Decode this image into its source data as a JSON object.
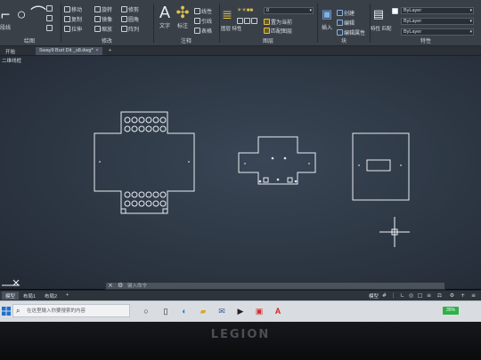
{
  "ribbon": {
    "draw_group_label": "绘图",
    "modify_group_label": "修改",
    "annotation_group_label": "注释",
    "layers_group_label": "图层",
    "block_group_label": "块",
    "properties_group_label": "特性",
    "tools": {
      "polyline": "段线",
      "move": "移动",
      "rotate": "旋转",
      "trim": "修剪",
      "copy": "复制",
      "mirror": "镜像",
      "fillet": "圆角",
      "stretch": "拉伸",
      "scale": "缩放",
      "array": "阵列",
      "text": "文字",
      "dimension": "标注",
      "linear": "线性",
      "leader": "引线",
      "table": "表格",
      "layer_properties": "图层\n特性",
      "layer_value": "0",
      "set_current": "置为当前",
      "match_layer": "匹配图层",
      "insert": "插入",
      "create": "创建",
      "edit": "编辑",
      "edit_attributes": "编辑属性",
      "match_properties": "特性\n匹配",
      "bylayer_color": "ByLayer",
      "bylayer_linetype": "ByLayer",
      "bylayer_lineweight": "ByLayer"
    }
  },
  "tabs": {
    "start": "开始",
    "document": "Sway9 Burt Dit _s8.dwg*",
    "new_tab": "+"
  },
  "viewport": {
    "label": "二维线框"
  },
  "command": {
    "placeholder": "键入命令"
  },
  "layout_tabs": [
    "模型",
    "布局1",
    "布局2",
    "+"
  ],
  "statusbar": {
    "model_label": "模型"
  },
  "taskbar": {
    "search_placeholder": "在这里输入你要搜索的内容",
    "battery": "35%"
  },
  "bezel": {
    "brand": "LEGION"
  },
  "colors": {
    "ribbon_bg": "#3a4048",
    "canvas_bg": "#2d3744",
    "drawing_line": "#ffffff",
    "acad_red": "#e02020"
  }
}
